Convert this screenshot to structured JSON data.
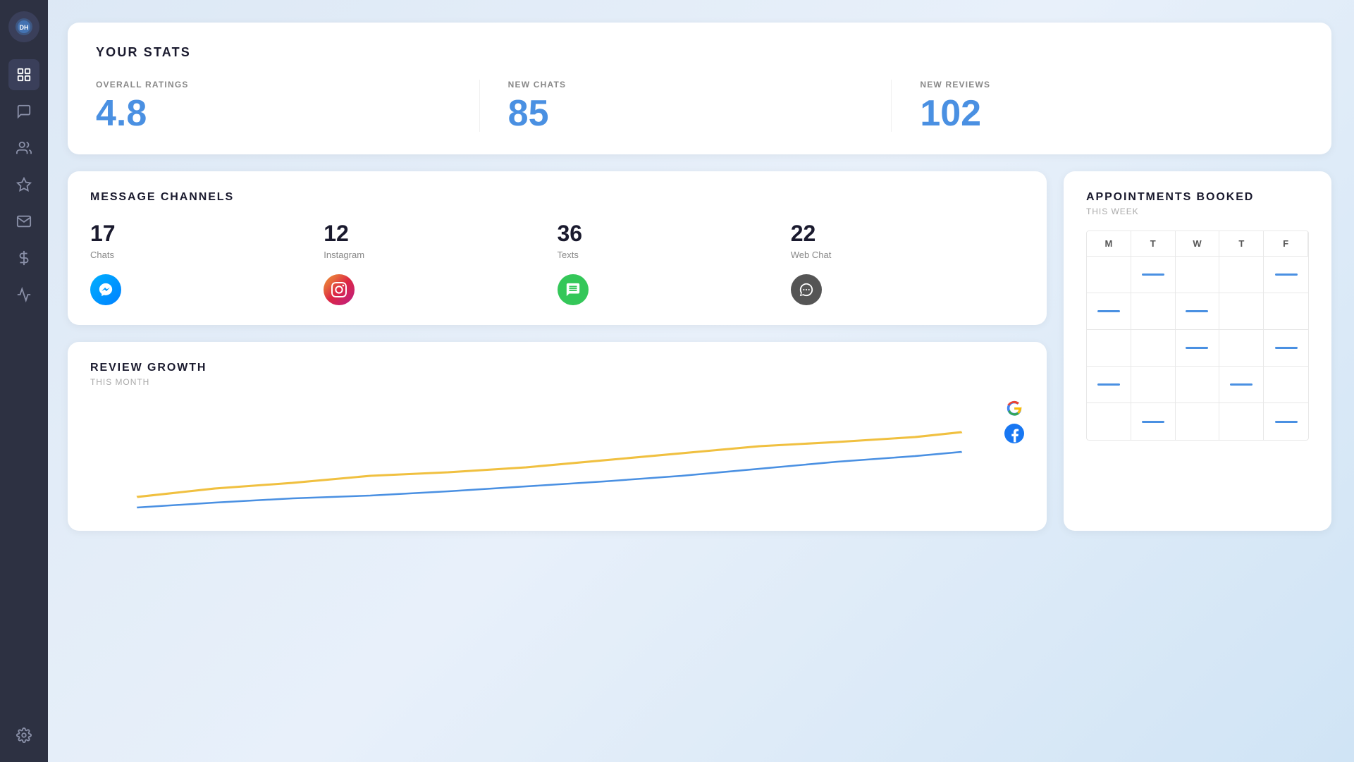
{
  "sidebar": {
    "logo_title": "DH Chat",
    "items": [
      {
        "name": "dashboard",
        "label": "Dashboard"
      },
      {
        "name": "chat",
        "label": "Chat"
      },
      {
        "name": "contacts",
        "label": "Contacts"
      },
      {
        "name": "reviews",
        "label": "Reviews"
      },
      {
        "name": "mail",
        "label": "Mail"
      },
      {
        "name": "billing",
        "label": "Billing"
      },
      {
        "name": "analytics",
        "label": "Analytics"
      },
      {
        "name": "settings",
        "label": "Settings"
      }
    ]
  },
  "stats": {
    "title": "YOUR STATS",
    "overall_ratings": {
      "label": "OVERALL RATINGS",
      "value": "4.8"
    },
    "new_chats": {
      "label": "NEW CHATS",
      "value": "85"
    },
    "new_reviews": {
      "label": "NEW REVIEWS",
      "value": "102"
    }
  },
  "channels": {
    "title": "MESSAGE CHANNELS",
    "items": [
      {
        "num": "17",
        "name": "Chats",
        "icon": "messenger"
      },
      {
        "num": "12",
        "name": "Instagram",
        "icon": "instagram"
      },
      {
        "num": "36",
        "name": "Texts",
        "icon": "texts"
      },
      {
        "num": "22",
        "name": "Web Chat",
        "icon": "webchat"
      }
    ]
  },
  "review_growth": {
    "title": "REVIEW GROWTH",
    "subtitle": "THIS MONTH"
  },
  "appointments": {
    "title": "APPOINTMENTS BOOKED",
    "subtitle": "THIS WEEK",
    "days": [
      "M",
      "T",
      "W",
      "T",
      "F"
    ],
    "calendar": [
      [
        false,
        true,
        false,
        false,
        true
      ],
      [
        true,
        false,
        true,
        false,
        false
      ],
      [
        false,
        false,
        true,
        false,
        true
      ],
      [
        true,
        false,
        false,
        true,
        false
      ],
      [
        false,
        true,
        false,
        false,
        true
      ]
    ]
  }
}
